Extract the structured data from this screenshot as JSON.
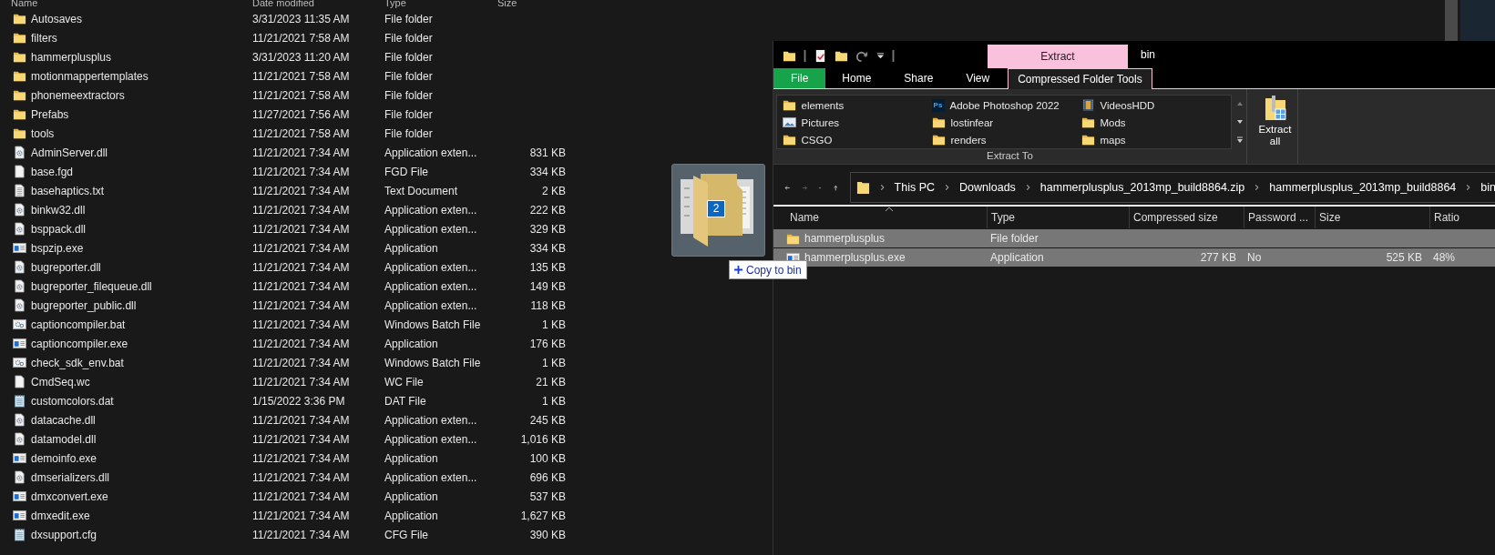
{
  "file_list": {
    "columns": [
      "Name",
      "Date modified",
      "Type",
      "Size"
    ],
    "rows": [
      {
        "kind": "folder",
        "name": "Autosaves",
        "date": "3/31/2023 11:35 AM",
        "type": "File folder"
      },
      {
        "kind": "folder",
        "name": "filters",
        "date": "11/21/2021 7:58 AM",
        "type": "File folder"
      },
      {
        "kind": "folder",
        "name": "hammerplusplus",
        "date": "3/31/2023 11:20 AM",
        "type": "File folder"
      },
      {
        "kind": "folder",
        "name": "motionmappertemplates",
        "date": "11/21/2021 7:58 AM",
        "type": "File folder"
      },
      {
        "kind": "folder",
        "name": "phonemeextractors",
        "date": "11/21/2021 7:58 AM",
        "type": "File folder"
      },
      {
        "kind": "folder",
        "name": "Prefabs",
        "date": "11/27/2021 7:56 AM",
        "type": "File folder"
      },
      {
        "kind": "folder",
        "name": "tools",
        "date": "11/21/2021 7:58 AM",
        "type": "File folder"
      },
      {
        "kind": "extension",
        "name": "AdminServer.dll",
        "date": "11/21/2021 7:34 AM",
        "type": "Application exten...",
        "size": "831 KB"
      },
      {
        "kind": "document",
        "name": "base.fgd",
        "date": "11/21/2021 7:34 AM",
        "type": "FGD File",
        "size": "334 KB"
      },
      {
        "kind": "text",
        "name": "basehaptics.txt",
        "date": "11/21/2021 7:34 AM",
        "type": "Text Document",
        "size": "2 KB"
      },
      {
        "kind": "extension",
        "name": "binkw32.dll",
        "date": "11/21/2021 7:34 AM",
        "type": "Application exten...",
        "size": "222 KB"
      },
      {
        "kind": "extension",
        "name": "bsppack.dll",
        "date": "11/21/2021 7:34 AM",
        "type": "Application exten...",
        "size": "329 KB"
      },
      {
        "kind": "application",
        "name": "bspzip.exe",
        "date": "11/21/2021 7:34 AM",
        "type": "Application",
        "size": "334 KB"
      },
      {
        "kind": "extension",
        "name": "bugreporter.dll",
        "date": "11/21/2021 7:34 AM",
        "type": "Application exten...",
        "size": "135 KB"
      },
      {
        "kind": "extension",
        "name": "bugreporter_filequeue.dll",
        "date": "11/21/2021 7:34 AM",
        "type": "Application exten...",
        "size": "149 KB"
      },
      {
        "kind": "extension",
        "name": "bugreporter_public.dll",
        "date": "11/21/2021 7:34 AM",
        "type": "Application exten...",
        "size": "118 KB"
      },
      {
        "kind": "batch",
        "name": "captioncompiler.bat",
        "date": "11/21/2021 7:34 AM",
        "type": "Windows Batch File",
        "size": "1 KB"
      },
      {
        "kind": "application",
        "name": "captioncompiler.exe",
        "date": "11/21/2021 7:34 AM",
        "type": "Application",
        "size": "176 KB"
      },
      {
        "kind": "batch",
        "name": "check_sdk_env.bat",
        "date": "11/21/2021 7:34 AM",
        "type": "Windows Batch File",
        "size": "1 KB"
      },
      {
        "kind": "document",
        "name": "CmdSeq.wc",
        "date": "11/21/2021 7:34 AM",
        "type": "WC File",
        "size": "21 KB"
      },
      {
        "kind": "data",
        "name": "customcolors.dat",
        "date": "1/15/2022 3:36 PM",
        "type": "DAT File",
        "size": "1 KB"
      },
      {
        "kind": "extension",
        "name": "datacache.dll",
        "date": "11/21/2021 7:34 AM",
        "type": "Application exten...",
        "size": "245 KB"
      },
      {
        "kind": "extension",
        "name": "datamodel.dll",
        "date": "11/21/2021 7:34 AM",
        "type": "Application exten...",
        "size": "1,016 KB"
      },
      {
        "kind": "application",
        "name": "demoinfo.exe",
        "date": "11/21/2021 7:34 AM",
        "type": "Application",
        "size": "100 KB"
      },
      {
        "kind": "extension",
        "name": "dmserializers.dll",
        "date": "11/21/2021 7:34 AM",
        "type": "Application exten...",
        "size": "696 KB"
      },
      {
        "kind": "application",
        "name": "dmxconvert.exe",
        "date": "11/21/2021 7:34 AM",
        "type": "Application",
        "size": "537 KB"
      },
      {
        "kind": "application",
        "name": "dmxedit.exe",
        "date": "11/21/2021 7:34 AM",
        "type": "Application",
        "size": "1,627 KB"
      },
      {
        "kind": "data",
        "name": "dxsupport.cfg",
        "date": "11/21/2021 7:34 AM",
        "type": "CFG File",
        "size": "390 KB"
      }
    ]
  },
  "drag": {
    "count": "2",
    "tooltip": "Copy to bin"
  },
  "window": {
    "title": "bin",
    "context_tab": "Extract",
    "tabs": [
      {
        "label": "File",
        "kind": "file",
        "selected": false
      },
      {
        "label": "Home",
        "kind": "tab",
        "selected": false
      },
      {
        "label": "Share",
        "kind": "tab",
        "selected": false
      },
      {
        "label": "View",
        "kind": "tab",
        "selected": false
      },
      {
        "label": "Compressed Folder Tools",
        "kind": "tab",
        "selected": true
      }
    ],
    "destinations": [
      {
        "kind": "folder",
        "label": "elements"
      },
      {
        "kind": "pictures",
        "label": "Pictures"
      },
      {
        "kind": "folder",
        "label": "CSGO"
      },
      {
        "kind": "app",
        "label": "Adobe Photoshop 2022",
        "logo": "Ps"
      },
      {
        "kind": "folder",
        "label": "lostinfear"
      },
      {
        "kind": "folder",
        "label": "renders"
      },
      {
        "kind": "video",
        "label": "VideosHDD"
      },
      {
        "kind": "folder",
        "label": "Mods"
      },
      {
        "kind": "folder",
        "label": "maps"
      }
    ],
    "group_label": "Extract To",
    "extract_all": "Extract all",
    "breadcrumbs": [
      "This PC",
      "Downloads",
      "hammerplusplus_2013mp_build8864.zip",
      "hammerplusplus_2013mp_build8864",
      "bin"
    ],
    "columns": [
      "Name",
      "Type",
      "Compressed size",
      "Password ...",
      "Size",
      "Ratio"
    ],
    "rows": [
      {
        "kind": "folder",
        "name": "hammerplusplus",
        "type": "File folder",
        "selected": true
      },
      {
        "kind": "application",
        "name": "hammerplusplus.exe",
        "type": "Application",
        "compressed": "277 KB",
        "password": "No",
        "size": "525 KB",
        "ratio": "48%",
        "selected": true
      }
    ]
  }
}
